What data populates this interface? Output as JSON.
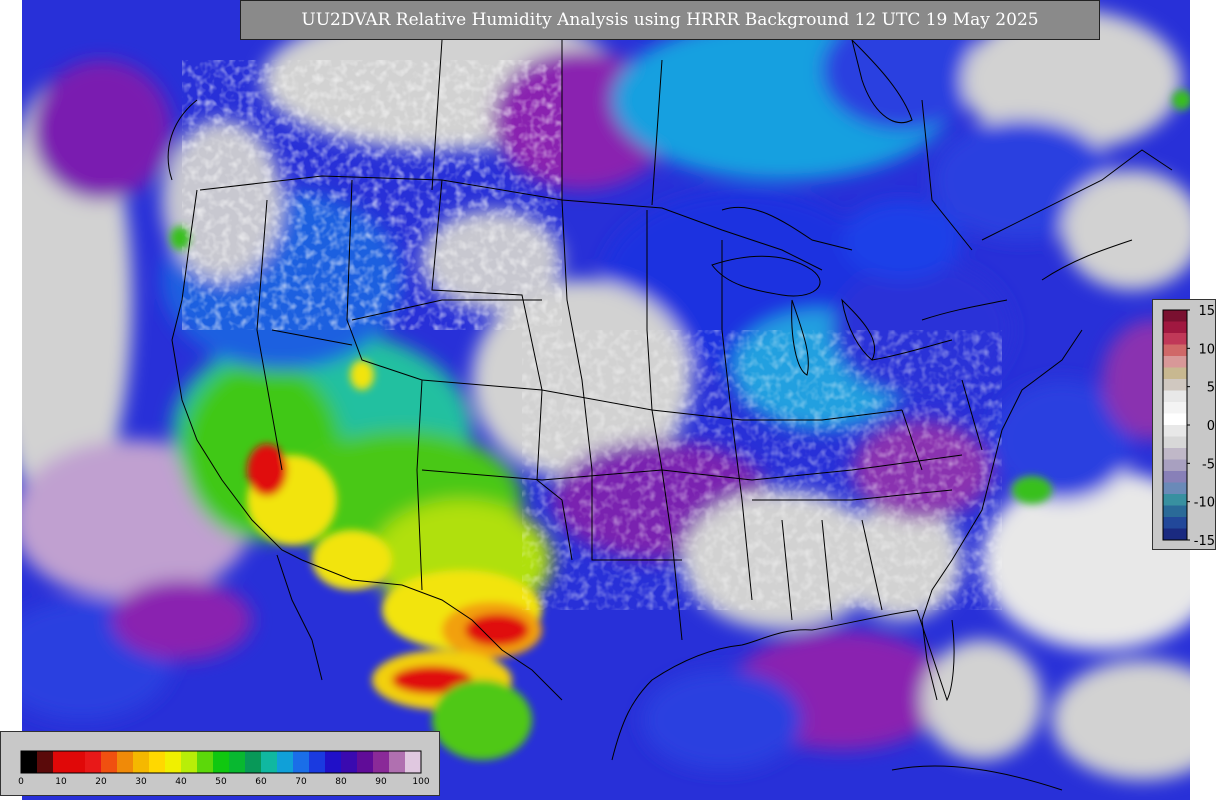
{
  "map": {
    "title": "UU2DVAR Relative Humidity Analysis using HRRR Background 12 UTC 19 May 2025",
    "colors": {
      "ocean_gray": "#d2d2d2",
      "very_moist_purple": "#6a0f9e",
      "moist_blue": "#1c25d6",
      "mid_cyan": "#12a8d6",
      "green": "#38c01c",
      "yellow": "#f2e40c",
      "orange": "#f2a00c",
      "red": "#e01010",
      "boundary_black": "#000000"
    }
  },
  "rh_colorbar": {
    "ticks": [
      "0",
      "10",
      "20",
      "30",
      "40",
      "50",
      "60",
      "70",
      "80",
      "90",
      "100"
    ],
    "colors": [
      "#000000",
      "#5a0a0a",
      "#e00808",
      "#e00808",
      "#e81818",
      "#f05010",
      "#f08a08",
      "#f5b800",
      "#ffd800",
      "#f0f000",
      "#b8ee08",
      "#5cd80a",
      "#10c810",
      "#08b830",
      "#089858",
      "#10b8a0",
      "#10a0d8",
      "#1a6ee8",
      "#1a3ae0",
      "#2010c8",
      "#3a0ab0",
      "#600c98",
      "#8a2a98",
      "#b070b0",
      "#e0c8e0"
    ]
  },
  "diff_colorbar": {
    "ticks": [
      "15",
      "10",
      "5",
      "0",
      "-5",
      "-10",
      "-15"
    ],
    "colors": [
      "#7a1030",
      "#a01840",
      "#c03858",
      "#d06868",
      "#d89898",
      "#c8b890",
      "#d0c8c0",
      "#e8e8e8",
      "#f4f4f4",
      "#ffffff",
      "#e8e8e8",
      "#d8d8d8",
      "#c0b8c8",
      "#a8a0c0",
      "#8880b8",
      "#6a8ab8",
      "#3890a0",
      "#2a6a98",
      "#22489a",
      "#1a2a80"
    ]
  }
}
